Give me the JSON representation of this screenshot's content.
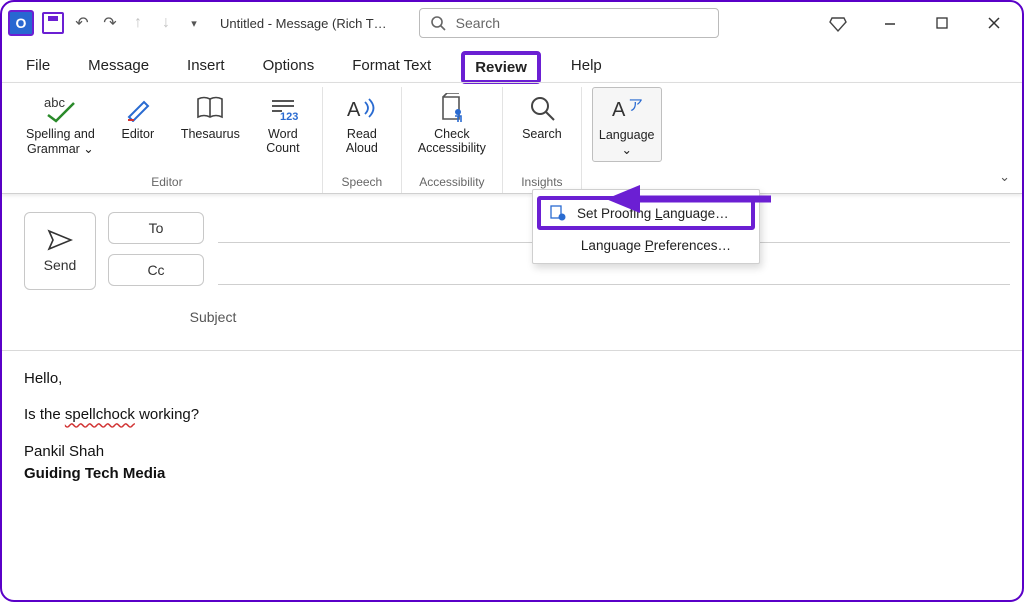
{
  "titlebar": {
    "app_initial": "O",
    "title": "Untitled  -  Message (Rich T…",
    "search_placeholder": "Search"
  },
  "tabs": [
    "File",
    "Message",
    "Insert",
    "Options",
    "Format Text",
    "Review",
    "Help"
  ],
  "active_tab_index": 5,
  "ribbon": {
    "groups": [
      {
        "label": "Editor",
        "buttons": [
          {
            "label": "Spelling and\nGrammar ⌄",
            "icon": "abc✓"
          },
          {
            "label": "Editor",
            "icon": "pen"
          },
          {
            "label": "Thesaurus",
            "icon": "book"
          },
          {
            "label": "Word\nCount",
            "icon": "123"
          }
        ]
      },
      {
        "label": "Speech",
        "buttons": [
          {
            "label": "Read\nAloud",
            "icon": "A)))"
          }
        ]
      },
      {
        "label": "Accessibility",
        "buttons": [
          {
            "label": "Check\nAccessibility",
            "icon": "doc-person"
          }
        ]
      },
      {
        "label": "Insights",
        "buttons": [
          {
            "label": "Search",
            "icon": "search"
          }
        ]
      },
      {
        "label": "",
        "buttons": [
          {
            "label": "Language\n⌄",
            "icon": "Aア"
          }
        ]
      }
    ],
    "language_menu": {
      "items": [
        {
          "label": "Set Proofing Language…",
          "underline": "L",
          "selected": true
        },
        {
          "label": "Language Preferences…",
          "underline": "P",
          "selected": false
        }
      ]
    }
  },
  "compose": {
    "send": "Send",
    "to": "To",
    "cc": "Cc",
    "subject_label": "Subject",
    "body_lines": {
      "greeting": "Hello,",
      "line1_pre": "Is the ",
      "line1_mis": "spellchock",
      "line1_post": " working?",
      "sig_name": "Pankil Shah",
      "sig_company": "Guiding Tech Media"
    }
  },
  "annotation": {
    "color": "#6b1fd3"
  }
}
